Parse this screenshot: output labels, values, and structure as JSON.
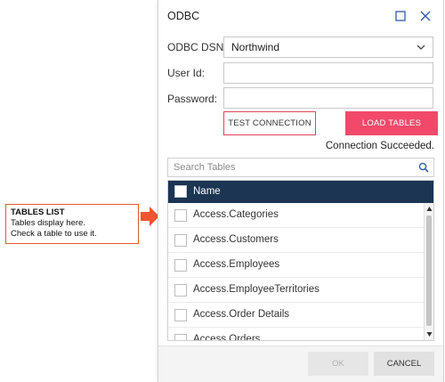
{
  "callout": {
    "title": "TABLES LIST",
    "line1": "Tables display here.",
    "line2": "Check a table to use it."
  },
  "dialog": {
    "title": "ODBC",
    "dsn_label": "ODBC DSN:",
    "dsn_value": "Northwind",
    "userid_label": "User Id:",
    "userid_value": "",
    "password_label": "Password:",
    "password_value": "",
    "test_button": "TEST CONNECTION",
    "load_button": "LOAD TABLES",
    "status": "Connection Succeeded.",
    "search_placeholder": "Search Tables",
    "column_header": "Name",
    "rows": [
      "Access.Categories",
      "Access.Customers",
      "Access.Employees",
      "Access.EmployeeTerritories",
      "Access.Order Details",
      "Access.Orders"
    ],
    "ok_button": "OK",
    "cancel_button": "CANCEL"
  },
  "colors": {
    "accent": "#f2496a",
    "header_bg": "#1b3553",
    "callout_border": "#e4572e"
  }
}
